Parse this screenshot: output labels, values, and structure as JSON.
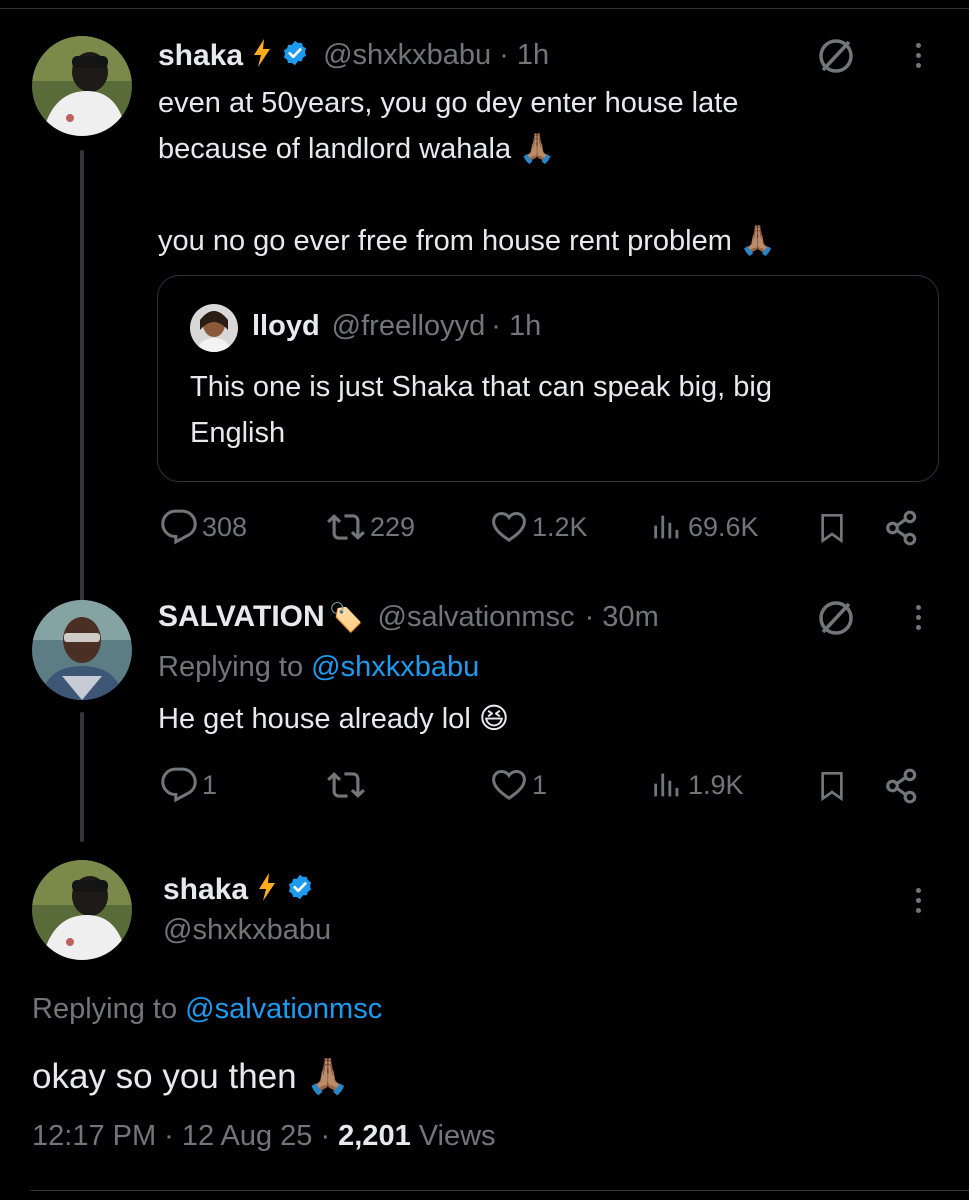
{
  "tweet1": {
    "name": "shaka",
    "handle": "@shxkxbabu",
    "time": "· 1h",
    "line1": "even at 50years, you go dey enter house late",
    "line2": "because of landlord wahala 🙏🏽",
    "line3": "you no go ever free from house rent problem 🙏🏽",
    "quote": {
      "name": "lloyd",
      "handle": "@freelloyyd",
      "time": "· 1h",
      "line1": "This one is just Shaka that can speak big, big",
      "line2": "English"
    },
    "stats": {
      "replies": "308",
      "reposts": "229",
      "likes": "1.2K",
      "views": "69.6K"
    }
  },
  "tweet2": {
    "name": "SALVATION",
    "name_emoji": "🏷️",
    "handle": "@salvationmsc",
    "time": "· 30m",
    "replying_prefix": "Replying to",
    "replying_handle": "@shxkxbabu",
    "text": "He get house already lol 😆",
    "stats": {
      "replies": "1",
      "reposts": "",
      "likes": "1",
      "views": "1.9K"
    }
  },
  "tweet3": {
    "name": "shaka",
    "handle": "@shxkxbabu",
    "replying_prefix": "Replying to",
    "replying_handle": "@salvationmsc",
    "text": "okay so you then 🙏🏽",
    "time": "12:17 PM",
    "date": "12 Aug 25",
    "views_count": "2,201",
    "views_label": "Views",
    "separator": "·"
  },
  "colors": {
    "background": "#000000",
    "text": "#e7e9ea",
    "muted": "#71767b",
    "link": "#1d9bf0",
    "verified": "#1d9bf0",
    "lightning": "#ffad1f"
  },
  "icons": [
    "lightning-icon",
    "verified-badge-icon",
    "grok-icon",
    "more-icon",
    "reply-icon",
    "repost-icon",
    "like-icon",
    "views-icon",
    "bookmark-icon",
    "share-icon"
  ]
}
